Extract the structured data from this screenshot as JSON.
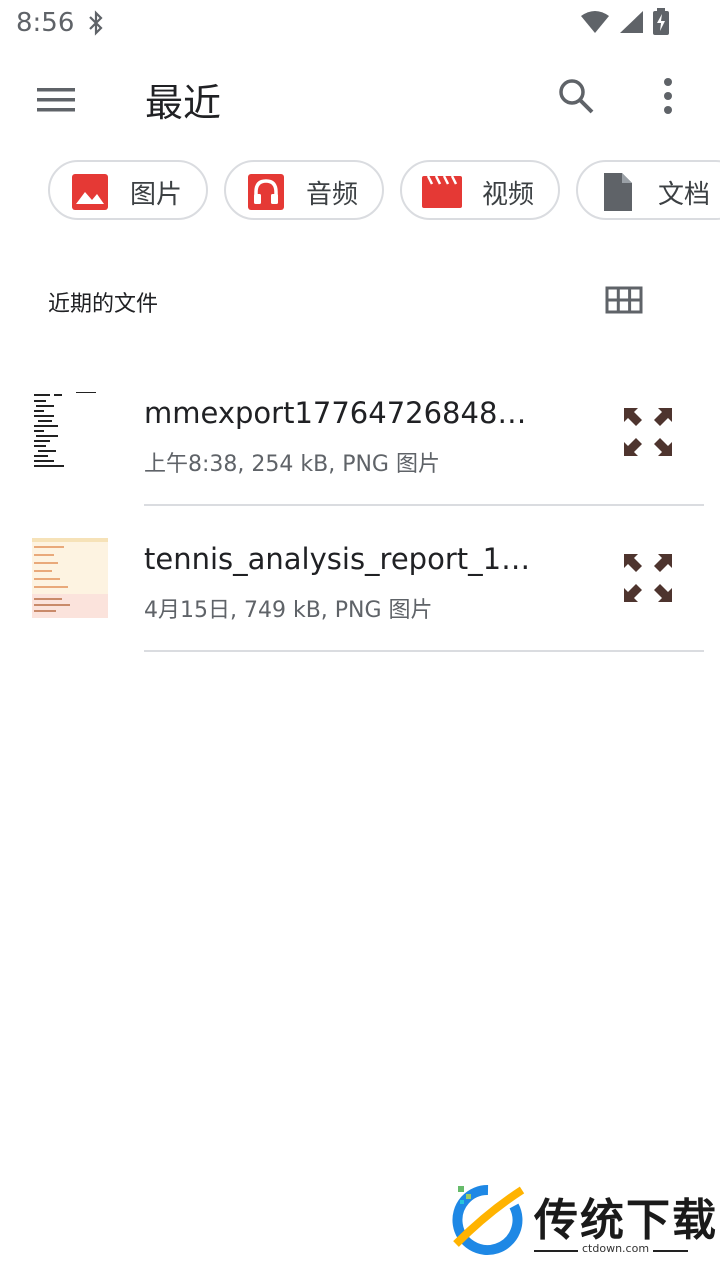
{
  "status_bar": {
    "time": "8:56"
  },
  "app_bar": {
    "title": "最近"
  },
  "chips": [
    {
      "label": "图片",
      "icon": "image-icon",
      "color": "#e53935"
    },
    {
      "label": "音频",
      "icon": "headphones-icon",
      "color": "#e53935"
    },
    {
      "label": "视频",
      "icon": "movie-icon",
      "color": "#e53935"
    },
    {
      "label": "文档",
      "icon": "document-icon",
      "color": "#5f6368"
    }
  ],
  "section": {
    "title": "近期的文件"
  },
  "files": [
    {
      "name": "mmexport177647268486…",
      "meta": "上午8:38, 254 kB, PNG 图片"
    },
    {
      "name": "tennis_analysis_report_17…",
      "meta": "4月15日, 749 kB, PNG 图片"
    }
  ],
  "watermark": {
    "brand": "传统下载",
    "url": "ctdown.com"
  }
}
